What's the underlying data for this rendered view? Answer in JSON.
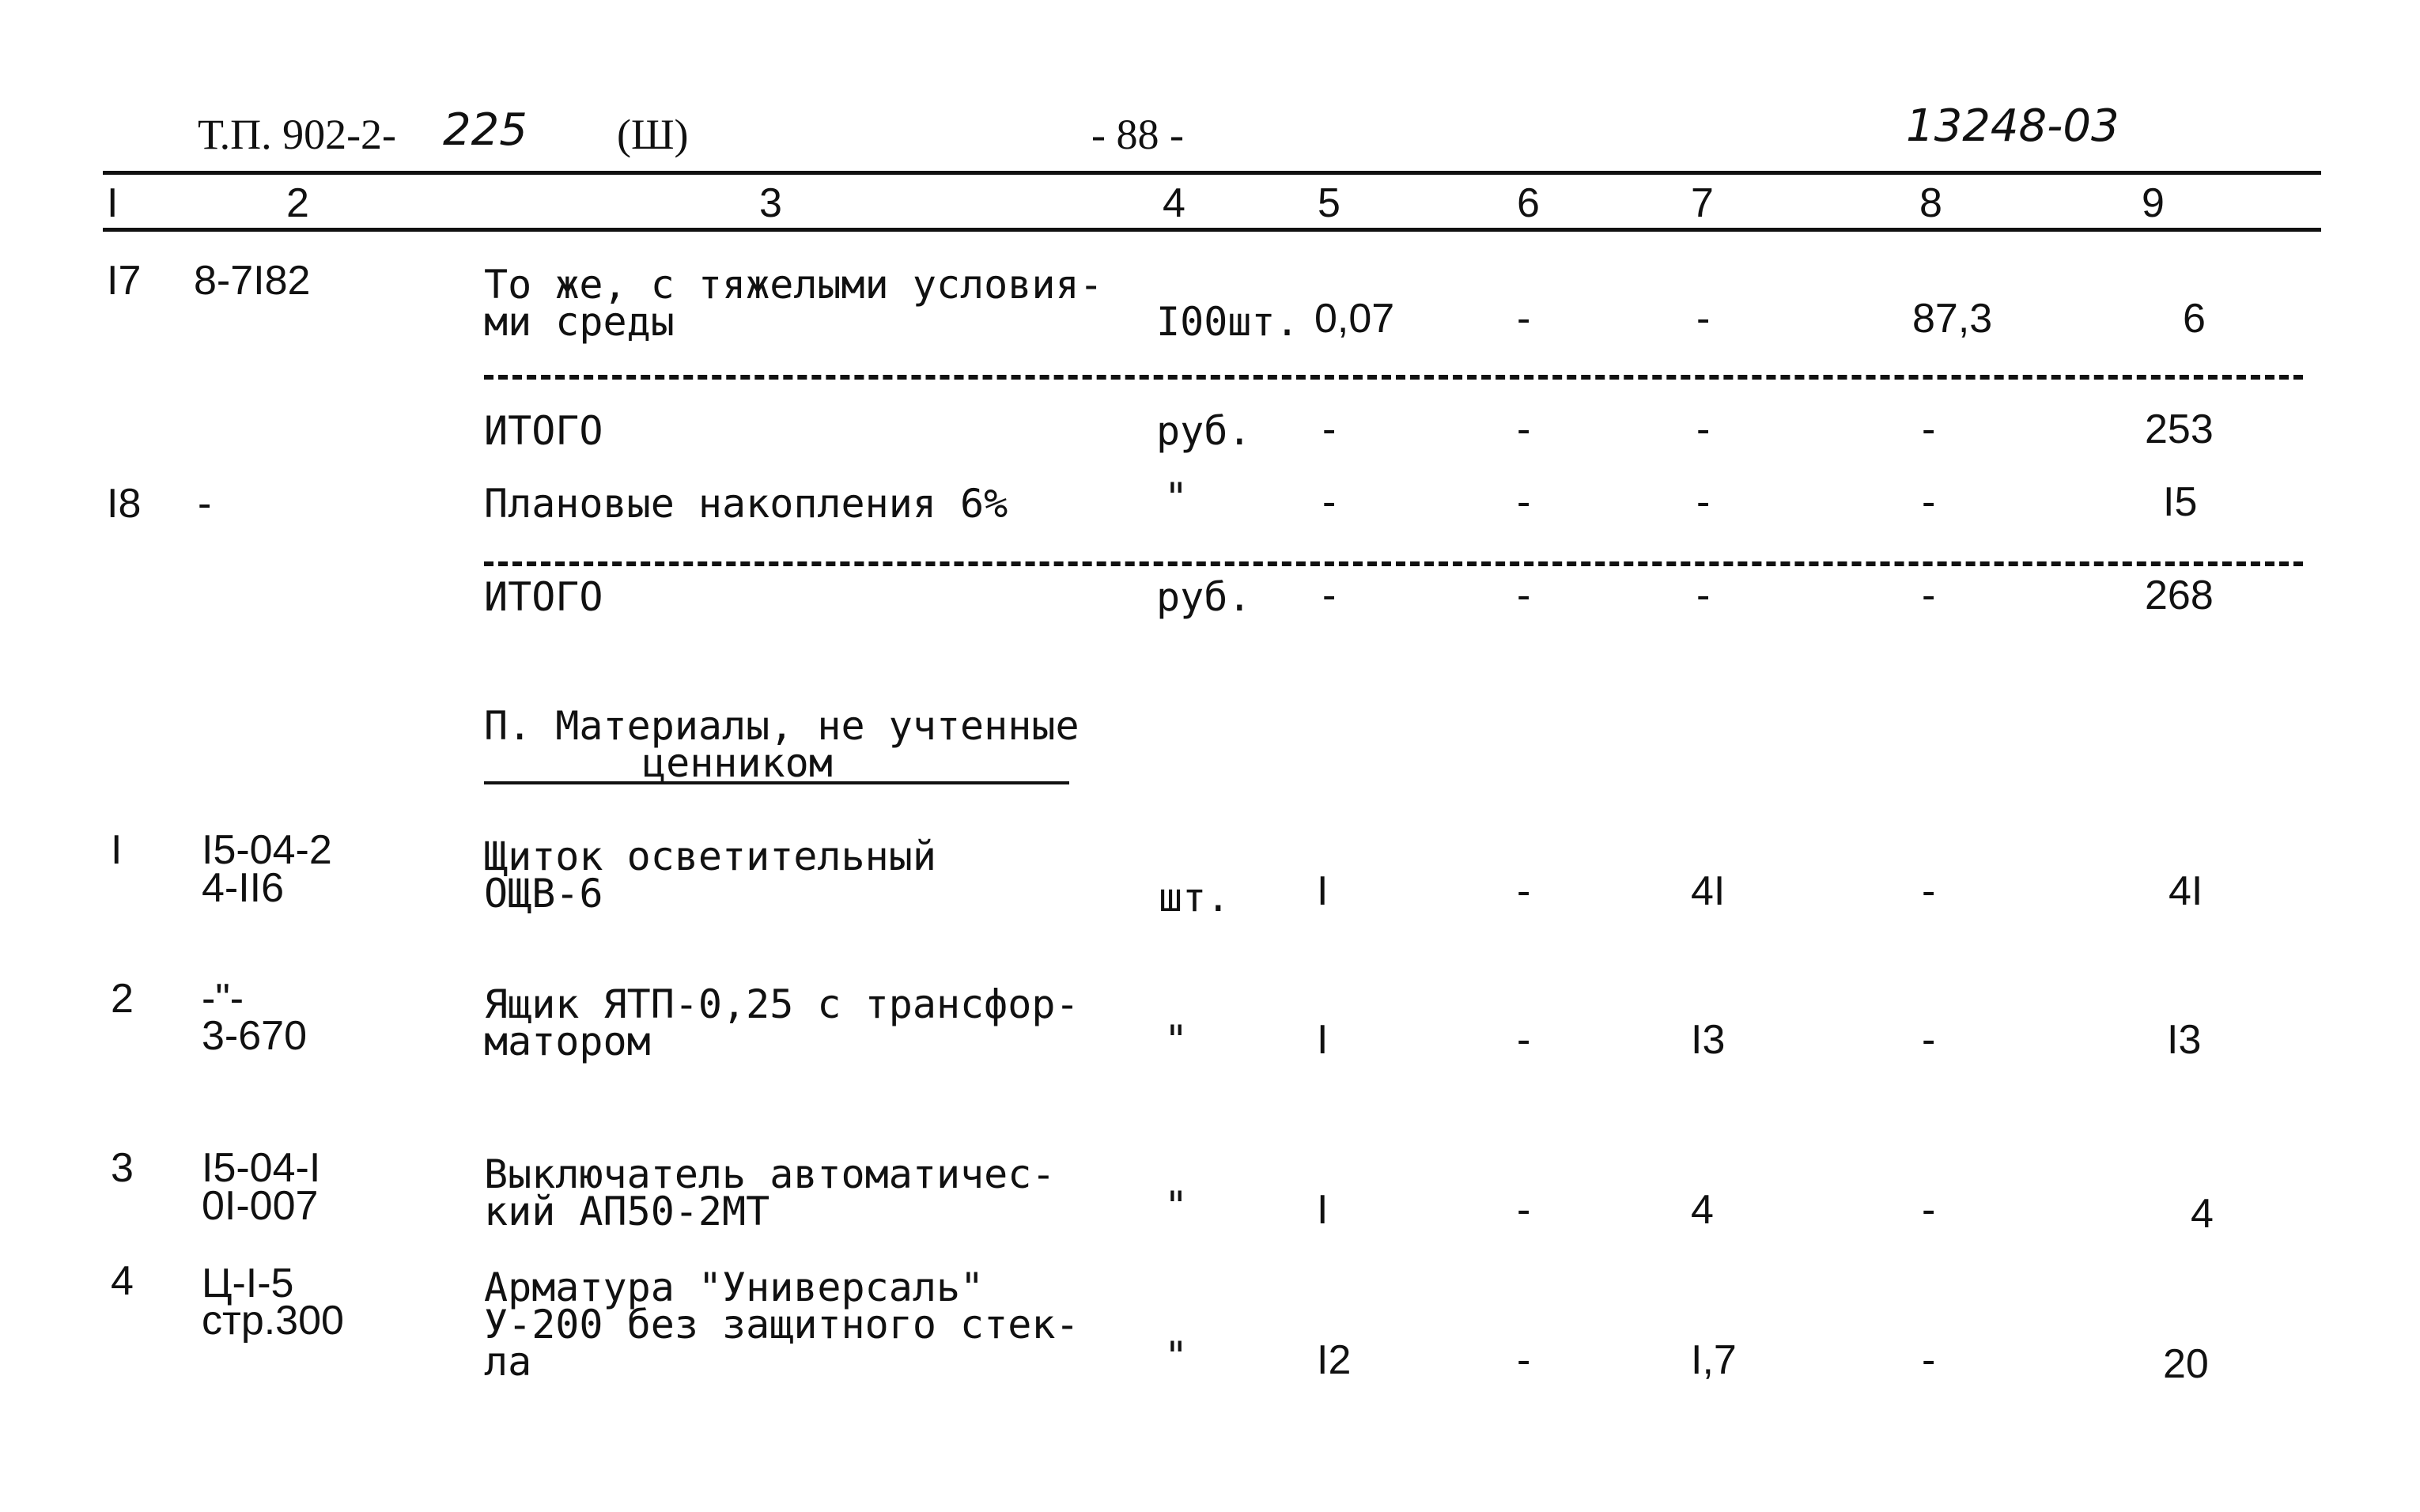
{
  "header": {
    "doc_code_prefix": "Т.П. 902-2-",
    "doc_code_suffix": "225",
    "part": "(Ш)",
    "page_number": "- 88 -",
    "stamp": "13248-03"
  },
  "columns": [
    "I",
    "2",
    "3",
    "4",
    "5",
    "6",
    "7",
    "8",
    "9"
  ],
  "rows_top": [
    {
      "no": "I7",
      "code": "8-7I82",
      "name": [
        "То же, с тяжелыми условия-",
        "ми среды"
      ],
      "unit": "I00шт.",
      "c5": "0,07",
      "c6": "-",
      "c7": "-",
      "c8": "87,3",
      "c9": "6"
    },
    {
      "no": "",
      "code": "",
      "name": [
        "ИТОГО"
      ],
      "unit": "руб.",
      "c5": "-",
      "c6": "-",
      "c7": "-",
      "c8": "-",
      "c9": "253"
    },
    {
      "no": "I8",
      "code": "-",
      "name": [
        "Плановые накопления 6%"
      ],
      "unit": "\"",
      "c5": "-",
      "c6": "-",
      "c7": "-",
      "c8": "-",
      "c9": "I5"
    },
    {
      "no": "",
      "code": "",
      "name": [
        "ИТОГО"
      ],
      "unit": "руб.",
      "c5": "-",
      "c6": "-",
      "c7": "-",
      "c8": "-",
      "c9": "268"
    }
  ],
  "section": {
    "title_line1": "П. Материалы, не учтенные",
    "title_line2": "ценником"
  },
  "rows_materials": [
    {
      "no": "I",
      "code": [
        "I5-04-2",
        "4-II6"
      ],
      "name": [
        "Щиток осветительный",
        "ОЩВ-6"
      ],
      "unit": "шт.",
      "c5": "I",
      "c6": "-",
      "c7": "4I",
      "c8": "-",
      "c9": "4I"
    },
    {
      "no": "2",
      "code": [
        "-\"-",
        "3-670"
      ],
      "name": [
        "Ящик ЯТП-0,25 с трансфор-",
        "матором"
      ],
      "unit": "\"",
      "c5": "I",
      "c6": "-",
      "c7": "I3",
      "c8": "-",
      "c9": "I3"
    },
    {
      "no": "3",
      "code": [
        "I5-04-I",
        "0I-007"
      ],
      "name": [
        "Выключатель автоматичес-",
        "кий АП50-2МТ"
      ],
      "unit": "\"",
      "c5": "I",
      "c6": "-",
      "c7": "4",
      "c8": "-",
      "c9": "4"
    },
    {
      "no": "4",
      "code": [
        "Ц-I-5",
        "стр.300"
      ],
      "name": [
        "Арматура \"Универсаль\"",
        "У-200 без защитного стек-",
        "ла"
      ],
      "unit": "\"",
      "c5": "I2",
      "c6": "-",
      "c7": "I,7",
      "c8": "-",
      "c9": "20"
    }
  ]
}
